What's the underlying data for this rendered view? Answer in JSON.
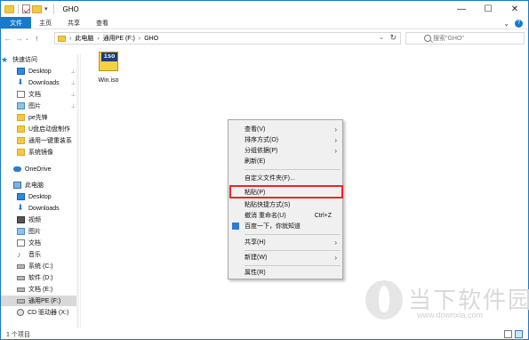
{
  "window": {
    "title": "GHO",
    "minimize_label": "—",
    "maximize_label": "☐",
    "close_label": "✕"
  },
  "ribbon": {
    "tabs": [
      "文件",
      "主页",
      "共享",
      "查看"
    ],
    "collapse_label": "⌄",
    "help_label": "?"
  },
  "address": {
    "back_label": "←",
    "forward_label": "→",
    "recent_label": "⌄",
    "up_label": "↑",
    "breadcrumbs": [
      "此电脑",
      "通用PE (F:)",
      "GHO"
    ],
    "separator": "›",
    "dropdown_label": "⌄",
    "refresh_label": "↻"
  },
  "search": {
    "placeholder": "搜索\"GHO\""
  },
  "sidebar": {
    "quick_access": "快速访问",
    "items": [
      {
        "label": "Desktop",
        "icon": "desktop-icon",
        "pinned": true
      },
      {
        "label": "Downloads",
        "icon": "download-icon",
        "pinned": true
      },
      {
        "label": "文档",
        "icon": "document-icon",
        "pinned": true
      },
      {
        "label": "图片",
        "icon": "picture-icon",
        "pinned": true
      },
      {
        "label": "pe先锋",
        "icon": "folder-icon",
        "pinned": false
      },
      {
        "label": "U盘启动盘制作",
        "icon": "folder-icon",
        "pinned": false
      },
      {
        "label": "通用一键重装系",
        "icon": "folder-icon",
        "pinned": false
      },
      {
        "label": "系统镜像",
        "icon": "folder-icon",
        "pinned": false
      }
    ],
    "onedrive": "OneDrive",
    "this_pc": "此电脑",
    "pc_items": [
      {
        "label": "Desktop",
        "icon": "desktop-icon"
      },
      {
        "label": "Downloads",
        "icon": "download-icon"
      },
      {
        "label": "视频",
        "icon": "video-icon"
      },
      {
        "label": "图片",
        "icon": "picture-icon"
      },
      {
        "label": "文档",
        "icon": "document-icon"
      },
      {
        "label": "音乐",
        "icon": "music-icon"
      },
      {
        "label": "系统 (C:)",
        "icon": "drive-icon"
      },
      {
        "label": "软件 (D:)",
        "icon": "drive-icon"
      },
      {
        "label": "文档 (E:)",
        "icon": "drive-icon"
      },
      {
        "label": "通用PE (F:)",
        "icon": "drive-icon",
        "selected": true
      },
      {
        "label": "CD 驱动器 (X:)",
        "icon": "cd-icon"
      }
    ],
    "pin_glyph": "📌"
  },
  "files": [
    {
      "name": "Win.iso",
      "icon_text": "iso"
    }
  ],
  "context_menu": {
    "groups": [
      [
        {
          "label": "查看(V)",
          "submenu": true
        },
        {
          "label": "排序方式(O)",
          "submenu": true
        },
        {
          "label": "分组依据(P)",
          "submenu": true
        },
        {
          "label": "刷新(E)",
          "submenu": false
        }
      ],
      [
        {
          "label": "自定义文件夹(F)...",
          "submenu": false
        }
      ],
      [
        {
          "label": "粘贴(P)",
          "submenu": false,
          "highlighted": true
        },
        {
          "label": "粘贴快捷方式(S)",
          "submenu": false
        },
        {
          "label": "撤消 重命名(U)",
          "submenu": false,
          "shortcut": "Ctrl+Z"
        },
        {
          "label": "百度一下，你就知道",
          "submenu": false,
          "icon": "baidu-icon"
        }
      ],
      [
        {
          "label": "共享(H)",
          "submenu": true
        }
      ],
      [
        {
          "label": "新建(W)",
          "submenu": true
        }
      ],
      [
        {
          "label": "属性(R)",
          "submenu": false
        }
      ]
    ],
    "submenu_glyph": "›"
  },
  "status": {
    "item_count": "1 个项目"
  },
  "watermark": {
    "title": "当下软件园",
    "url": "www.downxia.com"
  },
  "colors": {
    "accent": "#1979ca",
    "highlight_border": "#e8262c"
  }
}
